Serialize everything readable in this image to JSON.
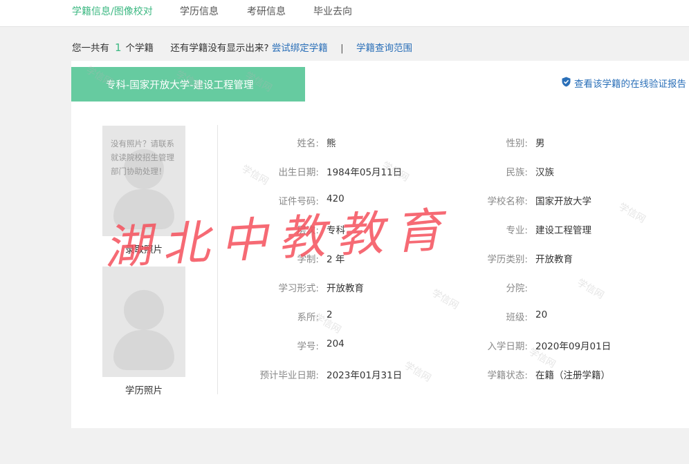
{
  "nav": {
    "items": [
      "学籍信息/图像校对",
      "学历信息",
      "考研信息",
      "毕业去向"
    ]
  },
  "summary": {
    "prefix": "您一共有",
    "count": "1",
    "suffix": "个学籍",
    "question": "还有学籍没有显示出来?",
    "bind_link": "尝试绑定学籍",
    "separator": "|",
    "scope_link": "学籍查询范围"
  },
  "record": {
    "tab_title": "专科-国家开放大学-建设工程管理",
    "verify_link": "查看该学籍的在线验证报告"
  },
  "photos": {
    "admission_msg": "没有照片？请联系就读院校招生管理部门协助处理！",
    "admission_caption": "录取照片",
    "degree_caption": "学历照片"
  },
  "fields": {
    "left": [
      {
        "label": "姓名:",
        "value": "熊"
      },
      {
        "label": "出生日期:",
        "value": "1984年05月11日"
      },
      {
        "label": "证件号码:",
        "value": "420"
      },
      {
        "label": "层次:",
        "value": "专科"
      },
      {
        "label": "学制:",
        "value": "2 年"
      },
      {
        "label": "学习形式:",
        "value": "开放教育"
      },
      {
        "label": "系所:",
        "value": "2"
      },
      {
        "label": "学号:",
        "value": "204"
      },
      {
        "label": "预计毕业日期:",
        "value": "2023年01月31日"
      }
    ],
    "right": [
      {
        "label": "性别:",
        "value": "男"
      },
      {
        "label": "民族:",
        "value": "汉族"
      },
      {
        "label": "学校名称:",
        "value": "国家开放大学"
      },
      {
        "label": "专业:",
        "value": "建设工程管理"
      },
      {
        "label": "学历类别:",
        "value": "开放教育"
      },
      {
        "label": "分院:",
        "value": ""
      },
      {
        "label": "班级:",
        "value": "20"
      },
      {
        "label": "入学日期:",
        "value": "2020年09月01日"
      },
      {
        "label": "学籍状态:",
        "value": "在籍（注册学籍）"
      }
    ]
  },
  "watermark": {
    "text": "湖北中教教育",
    "small": "学信网"
  },
  "colors": {
    "accent": "#3cb882",
    "tab_bg": "#66cba0",
    "link": "#2a6fb8",
    "watermark": "#f5505c"
  }
}
